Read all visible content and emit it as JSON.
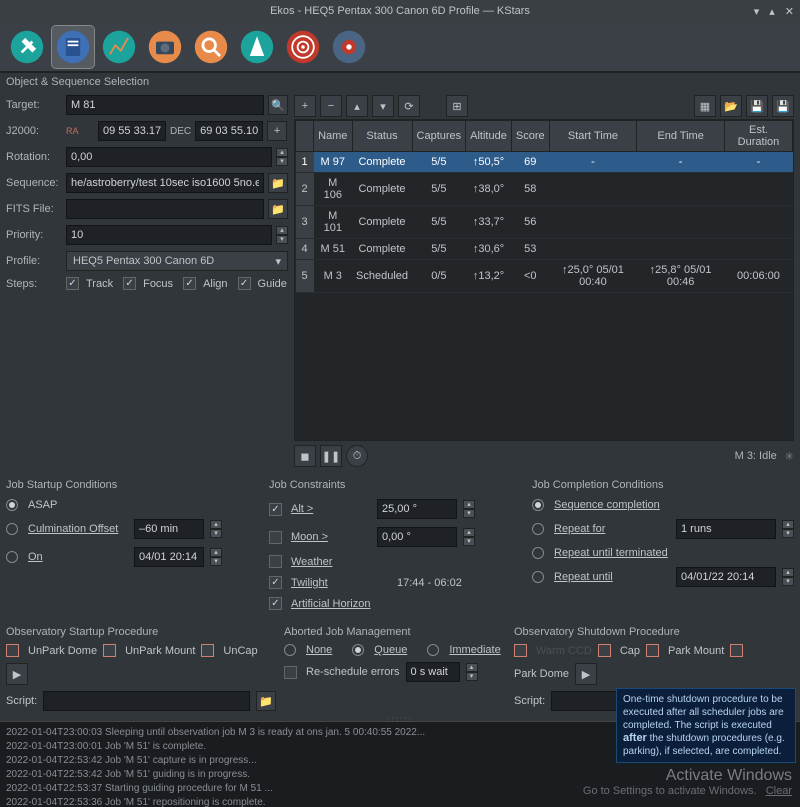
{
  "window": {
    "title": "Ekos - HEQ5 Pentax 300 Canon 6D Profile — KStars"
  },
  "section": {
    "object_sequence": "Object & Sequence Selection"
  },
  "form": {
    "target_lbl": "Target:",
    "target": "M 81",
    "j2000_lbl": "J2000:",
    "ra_lbl": "RA",
    "ra": "09 55 33.17",
    "dec_lbl": "DEC",
    "dec": "69 03 55.10",
    "rotation_lbl": "Rotation:",
    "rotation": "0,00",
    "sequence_lbl": "Sequence:",
    "sequence": "he/astroberry/test 10sec iso1600 5no.esq",
    "fits_lbl": "FITS File:",
    "fits": "",
    "priority_lbl": "Priority:",
    "priority": "10",
    "profile_lbl": "Profile:",
    "profile": "HEQ5 Pentax 300 Canon 6D",
    "steps_lbl": "Steps:",
    "track": "Track",
    "focus": "Focus",
    "align": "Align",
    "guide": "Guide"
  },
  "table": {
    "headers": [
      "",
      "Name",
      "Status",
      "Captures",
      "Altitude",
      "Score",
      "Start Time",
      "End Time",
      "Est. Duration"
    ],
    "rows": [
      {
        "n": "1",
        "name": "M 97",
        "status": "Complete",
        "cap": "5/5",
        "alt": "↑50,5°",
        "score": "69",
        "start": "-",
        "end": "-",
        "dur": "-"
      },
      {
        "n": "2",
        "name": "M 106",
        "status": "Complete",
        "cap": "5/5",
        "alt": "↑38,0°",
        "score": "58",
        "start": "",
        "end": "",
        "dur": ""
      },
      {
        "n": "3",
        "name": "M 101",
        "status": "Complete",
        "cap": "5/5",
        "alt": "↑33,7°",
        "score": "56",
        "start": "",
        "end": "",
        "dur": ""
      },
      {
        "n": "4",
        "name": "M 51",
        "status": "Complete",
        "cap": "5/5",
        "alt": "↑30,6°",
        "score": "53",
        "start": "",
        "end": "",
        "dur": ""
      },
      {
        "n": "5",
        "name": "M 3",
        "status": "Scheduled",
        "cap": "0/5",
        "alt": "↑13,2°",
        "score": "<0",
        "start": "↑25,0° 05/01 00:40",
        "end": "↑25,8° 05/01 00:46",
        "dur": "00:06:00"
      }
    ],
    "status_text": "M 3: Idle"
  },
  "startup": {
    "title": "Job Startup Conditions",
    "asap": "ASAP",
    "culm": "Culmination Offset",
    "culm_val": "–60 min",
    "on": "On",
    "on_val": "04/01 20:14"
  },
  "constraints": {
    "title": "Job Constraints",
    "alt": "Alt >",
    "alt_val": "25,00 °",
    "moon": "Moon  >",
    "moon_val": "0,00 °",
    "weather": "Weather",
    "twilight": "Twilight",
    "twilight_val": "17:44 - 06:02",
    "horizon": "Artificial Horizon"
  },
  "completion": {
    "title": "Job Completion Conditions",
    "seq": "Sequence completion",
    "repeat_for": "Repeat for",
    "repeat_for_val": "1 runs",
    "repeat_until_term": "Repeat until terminated",
    "repeat_until": "Repeat until",
    "repeat_until_val": "04/01/22 20:14"
  },
  "obs_startup": {
    "title": "Observatory Startup Procedure",
    "unpark_dome": "UnPark Dome",
    "unpark_mount": "UnPark Mount",
    "uncap": "UnCap",
    "script_lbl": "Script:"
  },
  "aborted": {
    "title": "Aborted Job Management",
    "none": "None",
    "queue": "Queue",
    "immediate": "Immediate",
    "resched": "Re-schedule errors",
    "wait": "0 s wait"
  },
  "obs_shutdown": {
    "title": "Observatory Shutdown Procedure",
    "warm": "Warm CCD",
    "cap": "Cap",
    "park_mount": "Park Mount",
    "park_dome": "Park Dome",
    "script_lbl": "Script:"
  },
  "log": [
    "2022-01-04T23:00:03 Sleeping until observation job M 3 is ready at ons jan. 5 00:40:55 2022...",
    "2022-01-04T23:00:01 Job 'M 51' is complete.",
    "2022-01-04T22:53:42 Job 'M 51' capture is in progress...",
    "2022-01-04T22:53:42 Job 'M 51' guiding is in progress.",
    "2022-01-04T22:53:37 Starting guiding procedure for M 51 ...",
    "2022-01-04T22:53:36 Job 'M 51' repositioning is complete."
  ],
  "tooltip": "One-time shutdown procedure to be executed after all scheduler jobs are completed. The script is executed after the shutdown procedures (e.g. parking), if selected, are completed.",
  "watermark": {
    "big": "Activate Windows",
    "small": "Go to Settings to activate Windows.",
    "clear": "Clear"
  }
}
